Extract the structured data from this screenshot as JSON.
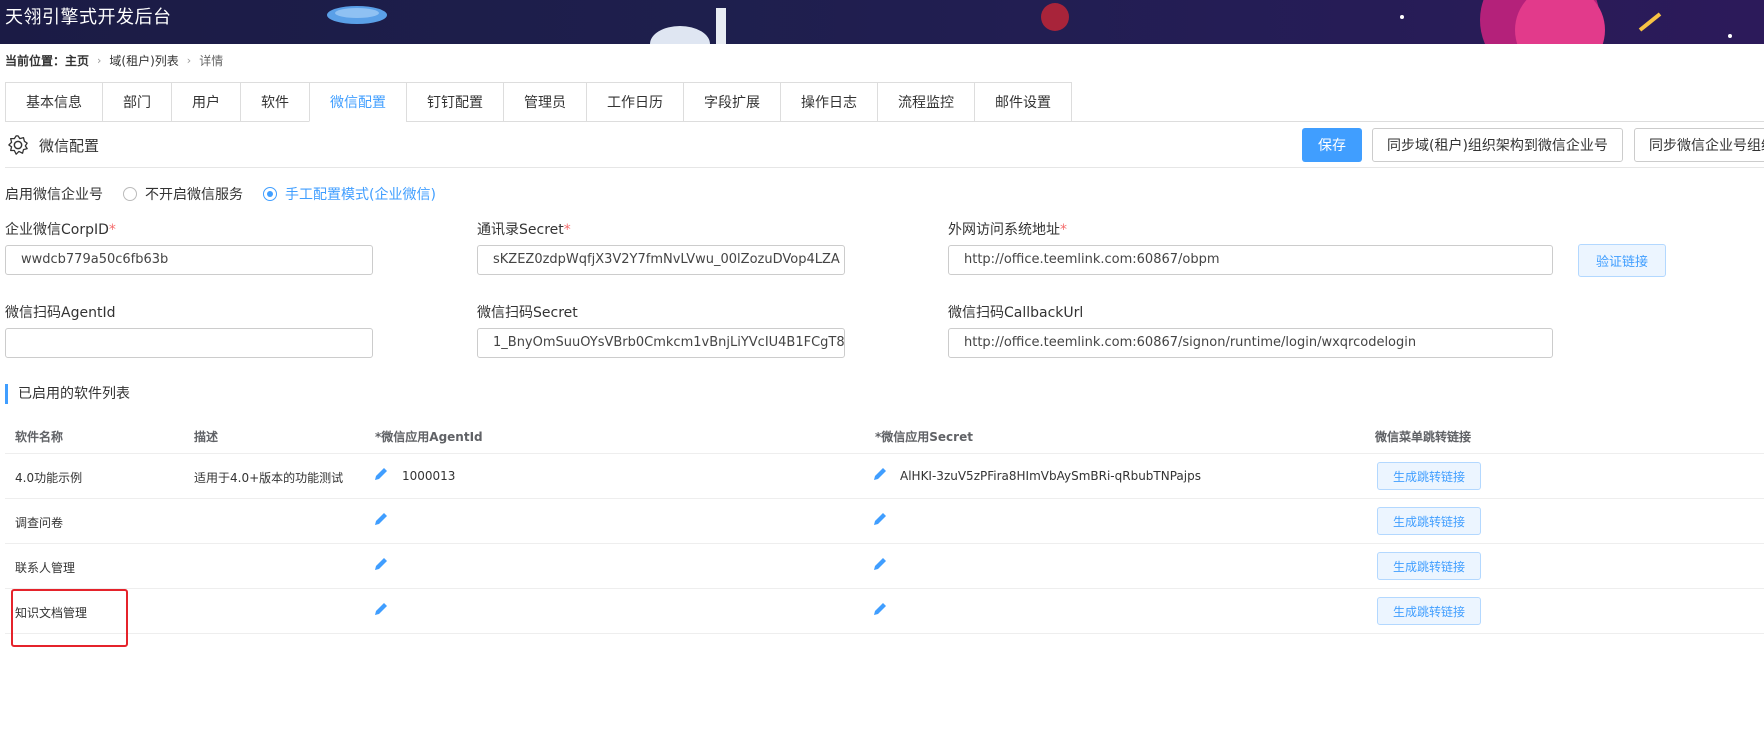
{
  "app": {
    "title": "天翎引擎式开发后台"
  },
  "breadcrumb": {
    "prefix": "当前位置：主页",
    "items": [
      "域(租户)列表",
      "详情"
    ]
  },
  "tabs": [
    "基本信息",
    "部门",
    "用户",
    "软件",
    "微信配置",
    "钉钉配置",
    "管理员",
    "工作日历",
    "字段扩展",
    "操作日志",
    "流程监控",
    "邮件设置"
  ],
  "active_tab": "微信配置",
  "section": {
    "title": "微信配置",
    "save_label": "保存",
    "sync_label": "同步域(租户)组织架构到微信企业号",
    "sync2_label": "同步微信企业号组织"
  },
  "enable": {
    "label": "启用微信企业号",
    "options": [
      "不开启微信服务",
      "手工配置模式(企业微信)"
    ],
    "selected": "手工配置模式(企业微信)"
  },
  "form": {
    "corpid": {
      "label": "企业微信CorpID",
      "value": "wwdcb779a50c6fb63b"
    },
    "contact_secret": {
      "label": "通讯录Secret",
      "value": "sKZEZ0zdpWqfjX3V2Y7fmNvLVwu_00lZozuDVop4LZA"
    },
    "external_url": {
      "label": "外网访问系统地址",
      "value": "http://office.teemlink.com:60867/obpm"
    },
    "verify_label": "验证链接",
    "scan_agentid": {
      "label": "微信扫码AgentId",
      "value": ""
    },
    "scan_secret": {
      "label": "微信扫码Secret",
      "value": "1_BnyOmSuuOYsVBrb0Cmkcm1vBnjLiYVcIU4B1FCgT8"
    },
    "scan_callback": {
      "label": "微信扫码CallbackUrl",
      "value": "http://office.teemlink.com:60867/signon/runtime/login/wxqrcodelogin"
    }
  },
  "table": {
    "title": "已启用的软件列表",
    "headers": [
      "软件名称",
      "描述",
      "*微信应用AgentId",
      "*微信应用Secret",
      "微信菜单跳转链接"
    ],
    "button_label": "生成跳转链接",
    "rows": [
      {
        "name": "4.0功能示例",
        "desc": "适用于4.0+版本的功能测试",
        "agentid": "1000013",
        "secret": "AlHKI-3zuV5zPFira8HImVbAySmBRi-qRbubTNPajps"
      },
      {
        "name": "调查问卷",
        "desc": "",
        "agentid": "",
        "secret": ""
      },
      {
        "name": "联系人管理",
        "desc": "",
        "agentid": "",
        "secret": ""
      },
      {
        "name": "知识文档管理",
        "desc": "",
        "agentid": "",
        "secret": ""
      }
    ]
  },
  "colors": {
    "accent": "#409eff",
    "highlight": "#e5232b",
    "banner": "#1e1f4d"
  }
}
